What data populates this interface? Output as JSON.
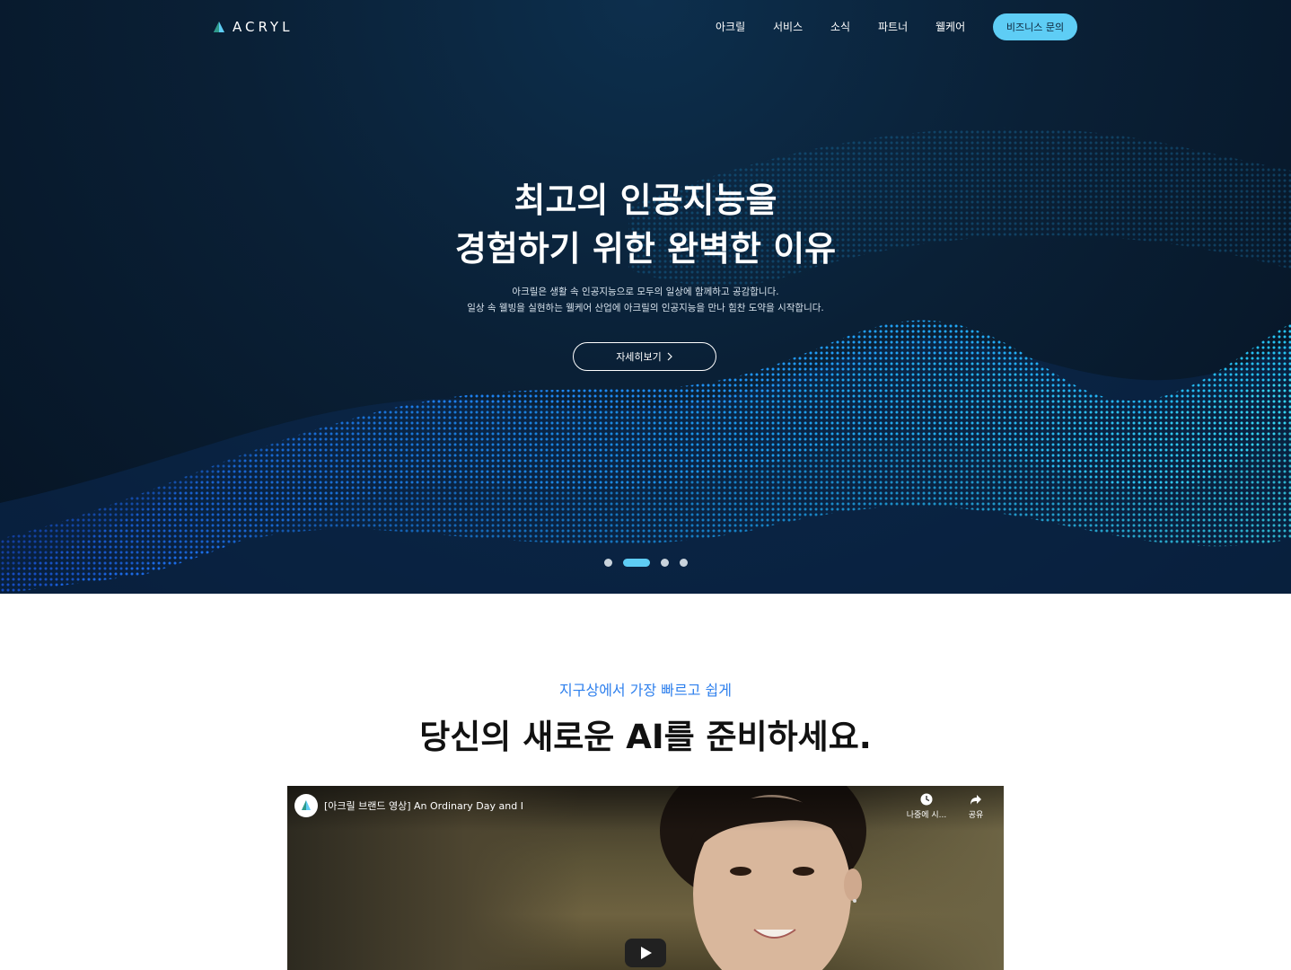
{
  "nav": {
    "logo_text": "ACRYL",
    "menu": [
      "아크릴",
      "서비스",
      "소식",
      "파트너",
      "웰케어"
    ],
    "cta_label": "비즈니스 문의"
  },
  "hero": {
    "title_line1": "최고의 인공지능을",
    "title_line2": "경험하기 위한 완벽한 이유",
    "sub_line1": "아크릴은 생활 속 인공지능으로 모두의 일상에 함께하고 공감합니다.",
    "sub_line2": "일상 속 웰빙을 실현하는 웰케어 산업에 아크릴의 인공지능을 만나 힘찬 도약을 시작합니다.",
    "button_label": "자세히보기",
    "carousel": {
      "count": 4,
      "active_index": 1
    }
  },
  "section": {
    "kicker": "지구상에서 가장 빠르고 쉽게",
    "headline": "당신의 새로운 AI를 준비하세요."
  },
  "video": {
    "title": "[아크릴 브랜드 영상] An Ordinary Day and I",
    "watch_later": "나중에 시...",
    "share": "공유"
  },
  "colors": {
    "accent": "#5ecdf5",
    "kicker": "#2f80ed",
    "hero_bg": "#0a2036"
  }
}
